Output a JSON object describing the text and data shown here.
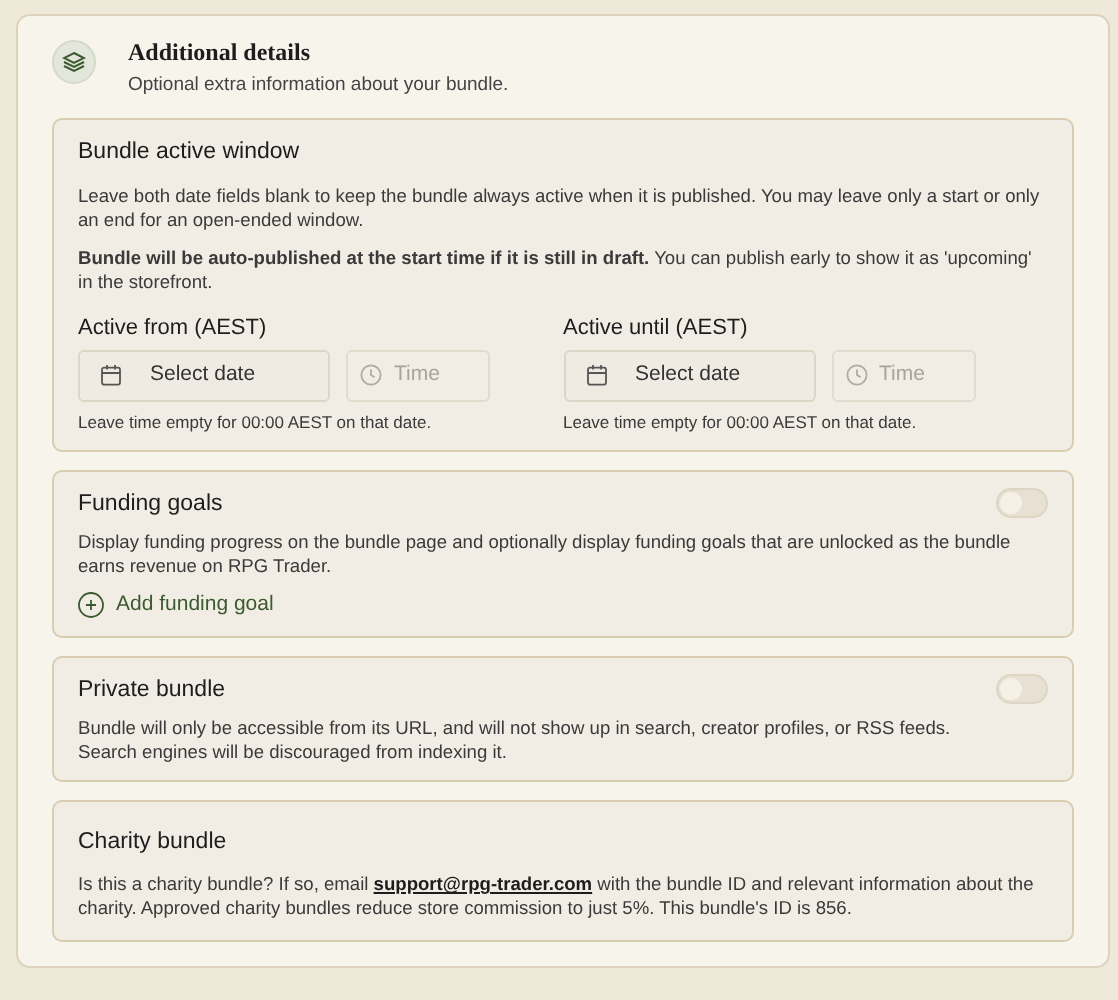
{
  "section": {
    "title": "Additional details",
    "subtitle": "Optional extra information about your bundle."
  },
  "active_window": {
    "title": "Bundle active window",
    "paragraphs": [
      "Leave both date fields blank to keep the bundle always active when it is published. You may leave only a start or only an end for an open-ended window.",
      "**Bundle will be auto-published at the start time if it is still in draft.** You can publish early to show it as 'upcoming' in the storefront."
    ],
    "fields": [
      {
        "label": "Active from (AEST)",
        "date_placeholder": "Select date",
        "time_placeholder": "Time",
        "hint": "Leave time empty for 00:00 AEST on that date."
      },
      {
        "label": "Active until (AEST)",
        "date_placeholder": "Select date",
        "time_placeholder": "Time",
        "hint": "Leave time empty for 00:00 AEST on that date."
      }
    ]
  },
  "funding_goals": {
    "title": "Funding goals",
    "on": false,
    "description": "Display funding progress on the bundle page and optionally display funding goals that are unlocked as the bundle earns revenue on RPG Trader.",
    "add_button": "Add funding goal"
  },
  "private_bundle": {
    "title": "Private bundle",
    "on": false,
    "description_lines": [
      "Bundle will only be accessible from its URL, and will not show up in search, creator profiles, or RSS feeds.",
      "Search engines will be discouraged from indexing it."
    ]
  },
  "charity_bundle": {
    "title": "Charity bundle",
    "text_before": "Is this a charity bundle? If so, email",
    "link": "support@rpg-trader.com",
    "text_after": "with the bundle ID and relevant information about the charity. Approved charity bundles reduce store commission to just 5%. This bundle's ID is 856."
  }
}
